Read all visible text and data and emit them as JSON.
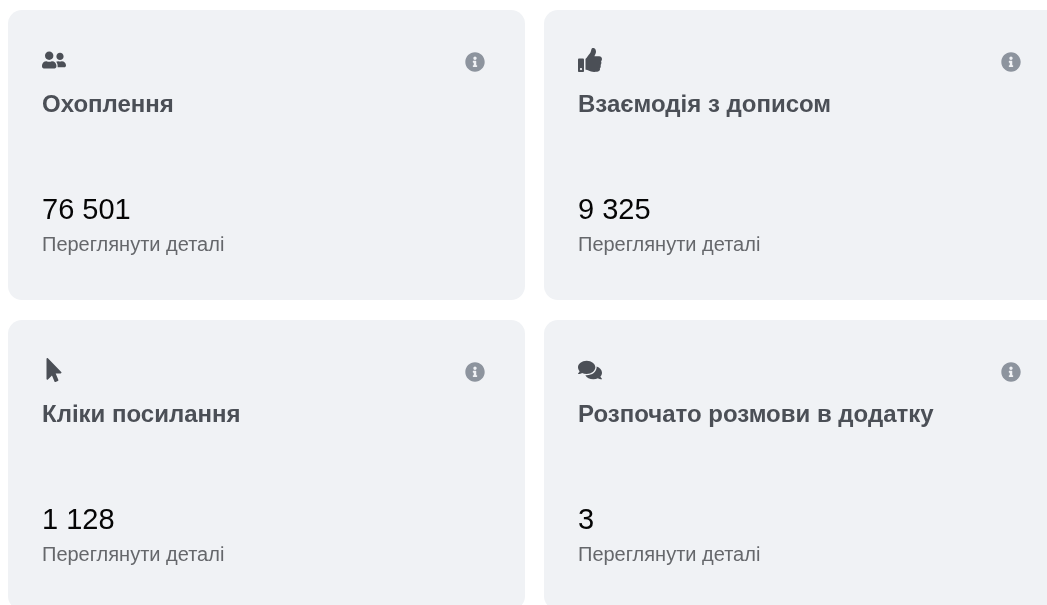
{
  "cards": [
    {
      "kind": "people",
      "title": "Охоплення",
      "value": "76 501",
      "link": "Переглянути деталі"
    },
    {
      "kind": "like",
      "title": "Взаємодія з дописом",
      "value": "9 325",
      "link": "Переглянути деталі"
    },
    {
      "kind": "cursor",
      "title": "Кліки посилання",
      "value": "1 128",
      "link": "Переглянути деталі"
    },
    {
      "kind": "chat",
      "title": "Розпочато розмови в додатку",
      "value": "3",
      "link": "Переглянути деталі"
    }
  ]
}
